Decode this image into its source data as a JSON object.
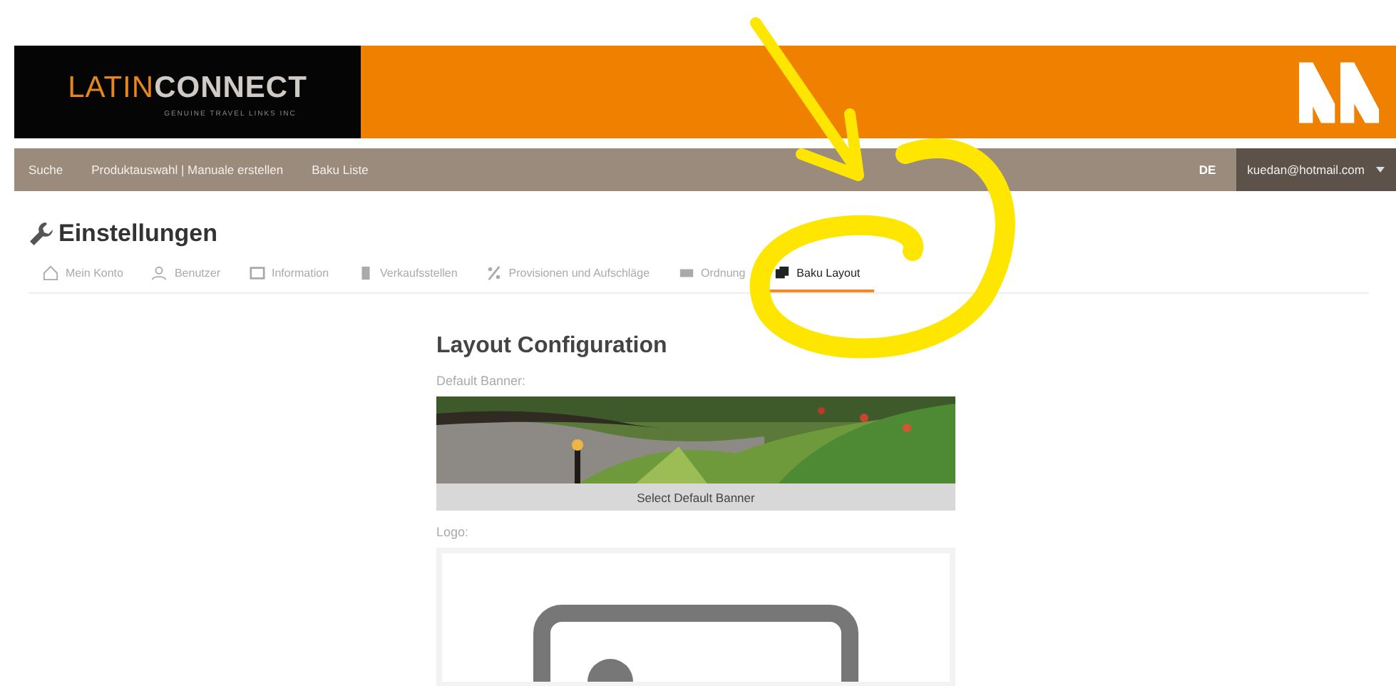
{
  "header": {
    "logo_light": "LATIN",
    "logo_dark": "CONNECT",
    "tagline": "GENUINE TRAVEL LINKS INC"
  },
  "nav": {
    "items": [
      {
        "label": "Suche"
      },
      {
        "label": "Produktauswahl | Manuale erstellen"
      },
      {
        "label": "Baku Liste"
      }
    ],
    "language": "DE",
    "account": "kuedan@hotmail.com"
  },
  "page_title": "Einstellungen",
  "tabs": [
    {
      "label": "Mein Konto",
      "selected": false
    },
    {
      "label": "Benutzer",
      "selected": false
    },
    {
      "label": "Information",
      "selected": false
    },
    {
      "label": "Verkaufsstellen",
      "selected": false
    },
    {
      "label": "Provisionen und Aufschläge",
      "selected": false
    },
    {
      "label": "Ordnung",
      "selected": false
    },
    {
      "label": "Baku Layout",
      "selected": true
    }
  ],
  "layout": {
    "title": "Layout Configuration",
    "banner_label": "Default Banner:",
    "banner_button": "Select Default Banner",
    "logo_label": "Logo:"
  }
}
